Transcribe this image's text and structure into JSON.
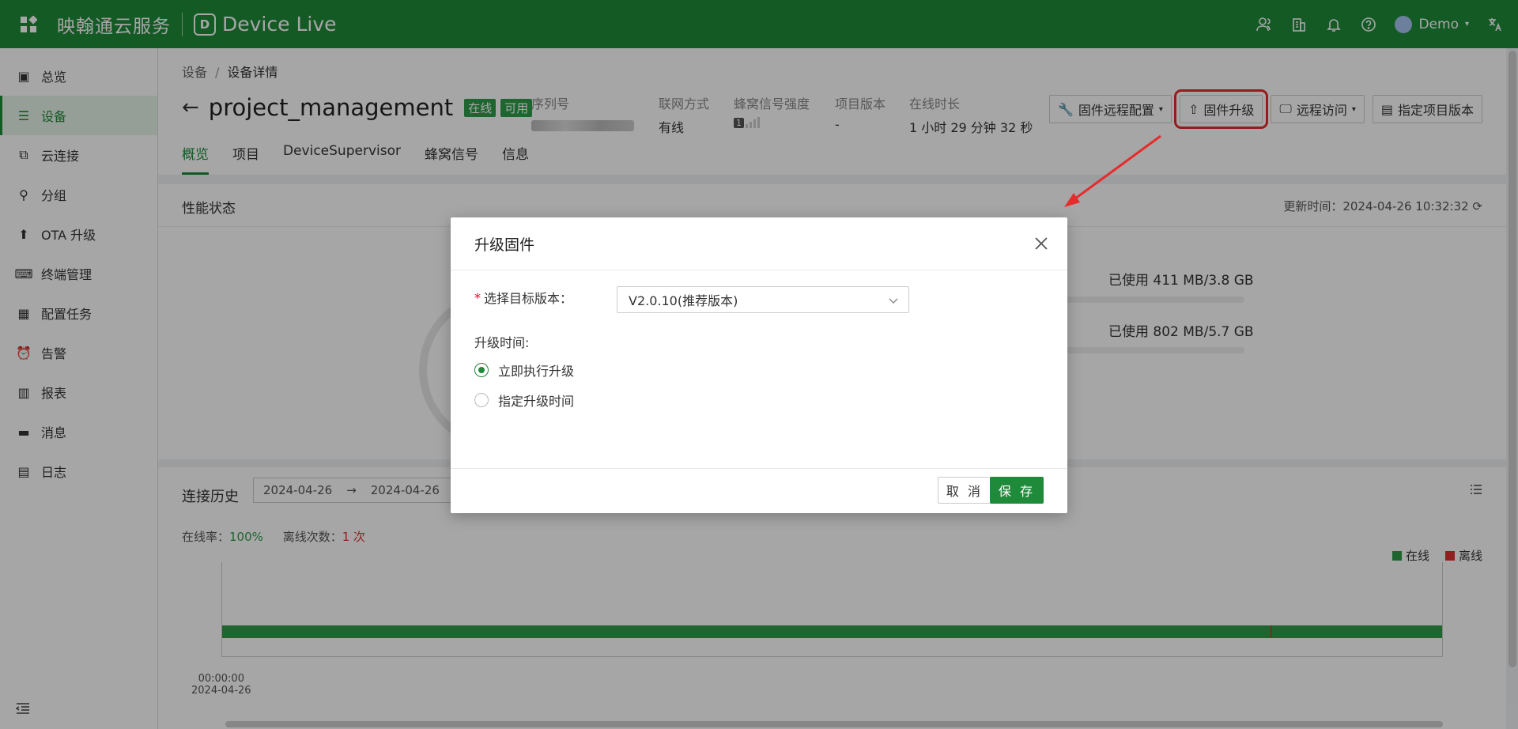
{
  "topbar": {
    "brand": "映翰通云服务",
    "product": "Device Live",
    "logo_letter": "D",
    "user": "Demo",
    "icons": [
      "user-group-icon",
      "building-icon",
      "bell-icon",
      "help-icon",
      "translate-icon"
    ]
  },
  "sidebar": {
    "items": [
      {
        "label": "总览",
        "icon": "dashboard-icon"
      },
      {
        "label": "设备",
        "icon": "device-list-icon",
        "active": true
      },
      {
        "label": "云连接",
        "icon": "cloud-connect-icon"
      },
      {
        "label": "分组",
        "icon": "group-icon"
      },
      {
        "label": "OTA 升级",
        "icon": "upload-arrow-icon"
      },
      {
        "label": "终端管理",
        "icon": "keyboard-icon"
      },
      {
        "label": "配置任务",
        "icon": "config-task-icon"
      },
      {
        "label": "告警",
        "icon": "alarm-icon"
      },
      {
        "label": "报表",
        "icon": "report-icon"
      },
      {
        "label": "消息",
        "icon": "message-icon"
      },
      {
        "label": "日志",
        "icon": "log-icon"
      }
    ]
  },
  "breadcrumb": {
    "root": "设备",
    "current": "设备详情"
  },
  "device": {
    "title": "project_management",
    "status_online": "在线",
    "status_available": "可用",
    "meta": {
      "serial_label": "序列号",
      "network_label": "联网方式",
      "network_value": "有线",
      "signal_label": "蜂窝信号强度",
      "signal_value": "1",
      "version_label": "项目版本",
      "version_value": "-",
      "uptime_label": "在线时长",
      "uptime_value": "1 小时 29 分钟 32 秒"
    }
  },
  "actions": {
    "remote_config": "固件远程配置",
    "firmware_upgrade": "固件升级",
    "remote_access": "远程访问",
    "assign_version": "指定项目版本"
  },
  "tabs": [
    "概览",
    "项目",
    "DeviceSupervisor",
    "蜂窝信号",
    "信息"
  ],
  "perf": {
    "title": "性能状态",
    "updated": "更新时间：2024-04-26 10:32:32",
    "memory_used": "已使用 411 MB/3.8 GB",
    "storage_used": "已使用 802 MB/5.7 GB"
  },
  "history": {
    "title": "连接历史",
    "date_start": "2024-04-26",
    "date_end": "2024-04-26",
    "online_rate_label": "在线率：",
    "online_rate_value": "100%",
    "offline_count_label": "离线次数：",
    "offline_count_value": "1 次",
    "legend_online": "在线",
    "legend_offline": "离线",
    "tick_time": "00:00:00",
    "tick_date": "2024-04-26",
    "colors": {
      "online": "#2e9b49",
      "offline": "#d33333"
    }
  },
  "modal": {
    "title": "升级固件",
    "target_label": "选择目标版本：",
    "target_value": "V2.0.10(推荐版本)",
    "time_label": "升级时间:",
    "option_now": "立即执行升级",
    "option_schedule": "指定升级时间",
    "cancel": "取 消",
    "save": "保 存"
  }
}
